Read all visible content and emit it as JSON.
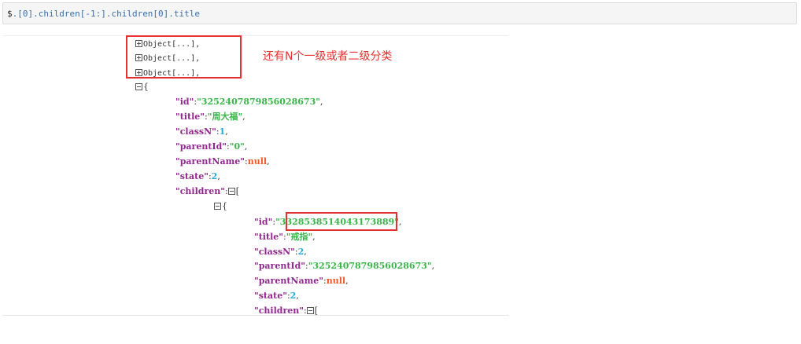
{
  "query": {
    "prefix": "$",
    "path": ".[0].children[-1:].children[0].title"
  },
  "tree": {
    "collapsed_label": "Object[...],",
    "open_brace": "{",
    "open_bracket": "[",
    "root": {
      "id": "3252407879856028673",
      "title": "周大福",
      "classN": "1",
      "parentId": "0",
      "parentName": "null",
      "state": "2"
    },
    "child": {
      "id": "3328538514043173889",
      "title": "戒指",
      "classN": "2",
      "parentId": "3252407879856028673",
      "parentName": "null",
      "state": "2"
    }
  },
  "annotation": {
    "text": "还有N个一级或者二级分类",
    "color": "#e5312f"
  },
  "colors": {
    "key": "#92278f",
    "string": "#3ab54a",
    "number": "#25aae1",
    "null": "#f1592a",
    "highlight": "#e5312f"
  },
  "icons": {
    "expand": "plus-square-icon",
    "collapse": "minus-square-icon"
  }
}
